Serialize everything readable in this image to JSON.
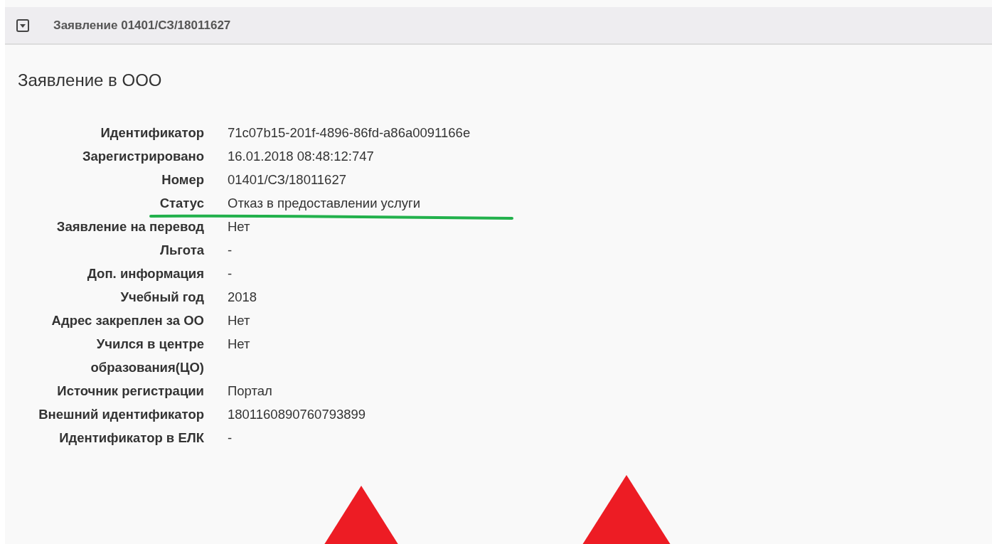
{
  "panel": {
    "title": "Заявление 01401/СЗ/18011627",
    "expanded": true
  },
  "heading": "Заявление в ООО",
  "fields": [
    {
      "label": "Идентификатор",
      "value": "71c07b15-201f-4896-86fd-a86a0091166e"
    },
    {
      "label": "Зарегистрировано",
      "value": "16.01.2018 08:48:12:747"
    },
    {
      "label": "Номер",
      "value": "01401/СЗ/18011627"
    },
    {
      "label": "Статус",
      "value": "Отказ в предоставлении услуги"
    },
    {
      "label": "Заявление на перевод",
      "value": "Нет"
    },
    {
      "label": "Льгота",
      "value": "-"
    },
    {
      "label": "Доп. информация",
      "value": "-"
    },
    {
      "label": "Учебный год",
      "value": "2018"
    },
    {
      "label": "Адрес закреплен за ОО",
      "value": "Нет"
    },
    {
      "label": "Учился в центре образования(ЦО)",
      "value": "Нет"
    },
    {
      "label": "Источник регистрации",
      "value": "Портал"
    },
    {
      "label": "Внешний идентификатор",
      "value": "1801160890760793899"
    },
    {
      "label": "Идентификатор в ЕЛК",
      "value": "-"
    }
  ]
}
